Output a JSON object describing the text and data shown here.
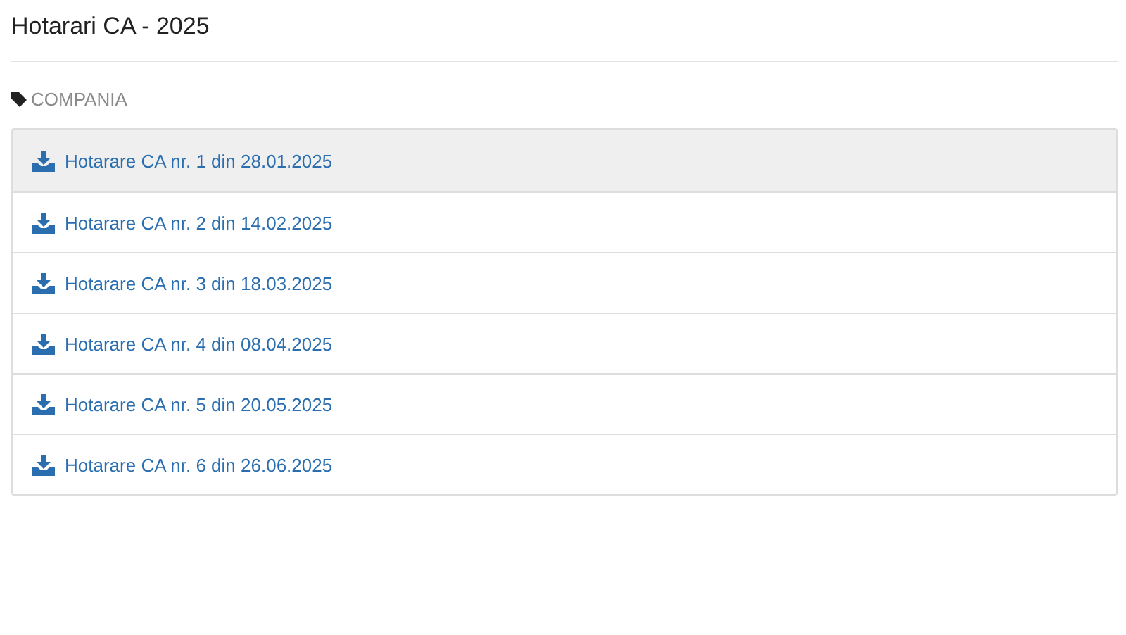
{
  "title": "Hotarari CA - 2025",
  "category": "COMPANIA",
  "documents": [
    {
      "label": "Hotarare CA nr. 1 din 28.01.2025",
      "selected": true
    },
    {
      "label": "Hotarare CA nr. 2 din 14.02.2025",
      "selected": false
    },
    {
      "label": "Hotarare CA nr. 3 din 18.03.2025",
      "selected": false
    },
    {
      "label": "Hotarare CA nr. 4 din 08.04.2025",
      "selected": false
    },
    {
      "label": "Hotarare CA nr. 5 din 20.05.2025",
      "selected": false
    },
    {
      "label": "Hotarare CA nr. 6 din 26.06.2025",
      "selected": false
    }
  ]
}
